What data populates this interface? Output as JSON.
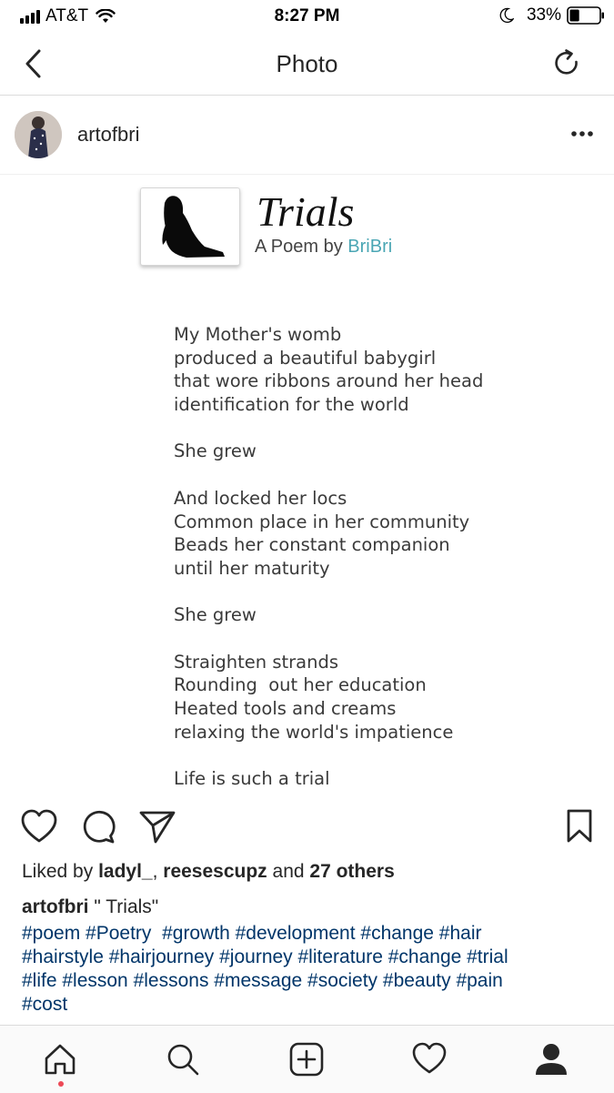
{
  "status_bar": {
    "carrier": "AT&T",
    "time": "8:27 PM",
    "battery": "33%",
    "battery_level": 0.33
  },
  "nav": {
    "title": "Photo"
  },
  "post": {
    "username": "artofbri",
    "poem": {
      "title": "Trials",
      "byline_prefix": "A Poem by ",
      "author": "BriBri",
      "lines": [
        "My Mother's womb",
        "produced a beautiful babygirl",
        "that wore ribbons around her head",
        "identification for the world",
        "",
        "She grew",
        "",
        "And locked her locs",
        "Common place in her community",
        "Beads her constant companion",
        "until her maturity",
        "",
        "She grew",
        "",
        "Straighten strands",
        "Rounding  out her education",
        "Heated tools and creams",
        "relaxing the world's impatience",
        "",
        "Life is such a trial"
      ]
    },
    "likes": {
      "prefix": "Liked by ",
      "user1": "ladyl_",
      "separator": ", ",
      "user2": "reesescupz",
      "middle": " and ",
      "others": "27 others"
    },
    "caption": {
      "username": "artofbri",
      "text": " \" Trials\""
    },
    "hashtag_lines": [
      "#poem #Poetry  #growth #development #change #hair",
      "#hairstyle #hairjourney #journey #literature #change #trial",
      "#life #lesson #lessons #message #society #beauty #pain",
      "#cost"
    ]
  },
  "colors": {
    "hashtag": "#003569",
    "author_accent": "#4aa6b4",
    "notification_dot": "#ed4956"
  },
  "icons": {
    "status": [
      "signal-icon",
      "wifi-icon",
      "moon-icon",
      "battery-icon"
    ],
    "nav": [
      "back-icon",
      "refresh-icon"
    ],
    "actions": [
      "heart-icon",
      "comment-icon",
      "share-icon",
      "bookmark-icon"
    ],
    "tabs": [
      "home-icon",
      "search-icon",
      "add-post-icon",
      "activity-heart-icon",
      "profile-icon"
    ]
  }
}
